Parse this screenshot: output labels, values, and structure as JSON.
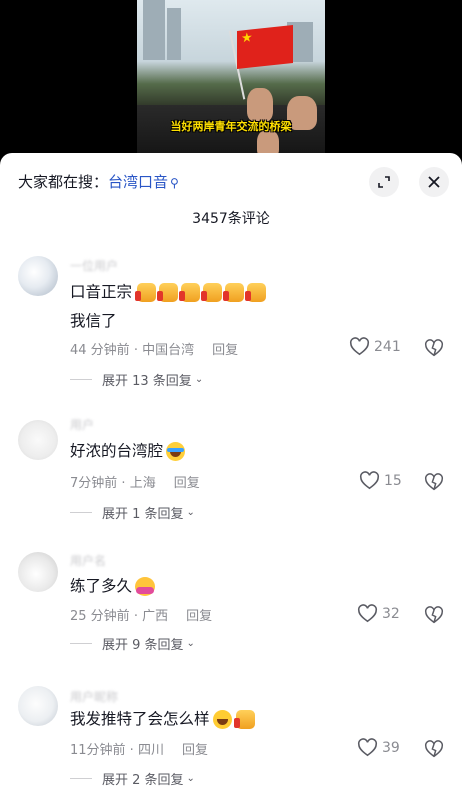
{
  "video": {
    "caption": "当好两岸青年交流的桥梁"
  },
  "sheet": {
    "search_prefix": "大家都在搜：",
    "search_keyword": "台湾口音",
    "comment_count_title": "3457条评论"
  },
  "comments": [
    {
      "username": "一位用户",
      "text_lines": [
        "口音正宗",
        "我信了"
      ],
      "emoji_after_first_line": [
        "thumbs-up-icon",
        "thumbs-up-icon",
        "thumbs-up-icon",
        "thumbs-up-icon",
        "thumbs-up-icon",
        "thumbs-up-icon"
      ],
      "time": "44 分钟前",
      "location": "中国台湾",
      "reply": "回复",
      "likes": "241",
      "expand": "展开 13 条回复"
    },
    {
      "username": "用户",
      "text_lines": [
        "好浓的台湾腔"
      ],
      "emoji_after_first_line": [
        "crying-laughing-icon"
      ],
      "time": "7分钟前",
      "location": "上海",
      "reply": "回复",
      "likes": "15",
      "expand": "展开 1 条回复"
    },
    {
      "username": "用户名",
      "text_lines": [
        "练了多久"
      ],
      "emoji_after_first_line": [
        "hug-face-icon"
      ],
      "time": "25 分钟前",
      "location": "广西",
      "reply": "回复",
      "likes": "32",
      "expand": "展开 9 条回复"
    },
    {
      "username": "用户昵称",
      "text_lines": [
        "我发推特了会怎么样"
      ],
      "emoji_after_first_line": [
        "grinning-sweat-icon",
        "thumbs-up-icon"
      ],
      "time": "11分钟前",
      "location": "四川",
      "reply": "回复",
      "likes": "39",
      "expand": "展开 2 条回复"
    }
  ],
  "colors": {
    "search_keyword": "#2a56c6",
    "text": "#161823",
    "meta": "#8a8b91",
    "flag": "#e0221b"
  }
}
